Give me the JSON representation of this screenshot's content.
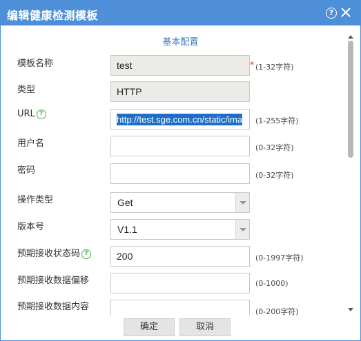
{
  "dialog": {
    "title": "编辑健康检测模板",
    "help_glyph": "?",
    "section_title": "基本配置"
  },
  "form": {
    "name_label": "模板名称",
    "name_value": "test",
    "name_required": "*",
    "name_hint": "(1-32字符)",
    "type_label": "类型",
    "type_value": "HTTP",
    "url_label": "URL",
    "url_value": "http://test.sge.com.cn/static/ima",
    "url_hint": "(1-255字符)",
    "username_label": "用户名",
    "username_value": "",
    "username_hint": "(0-32字符)",
    "password_label": "密码",
    "password_value": "",
    "password_hint": "(0-32字符)",
    "operation_label": "操作类型",
    "operation_value": "Get",
    "version_label": "版本号",
    "version_value": "V1.1",
    "status_code_label": "预期接收状态码",
    "status_code_value": "200",
    "status_code_hint": "(0-1997字符)",
    "recv_offset_label": "预期接收数据偏移",
    "recv_offset_value": "",
    "recv_offset_hint": "(0-1000)",
    "recv_content_label": "预期接收数据内容",
    "recv_content_value": "",
    "recv_content_hint": "(0-200字符)"
  },
  "footer": {
    "ok_label": "确定",
    "cancel_label": "取消"
  },
  "colors": {
    "titlebar": "#4e8fd8",
    "section_title": "#3a7bc6",
    "required": "#e03030",
    "help_icon_green": "#4db34d",
    "selection": "#1e6ec8"
  },
  "icons": {
    "help": "help-circle-icon",
    "close": "close-icon",
    "field_help": "question-circle-icon",
    "dropdown": "chevron-down-icon"
  }
}
